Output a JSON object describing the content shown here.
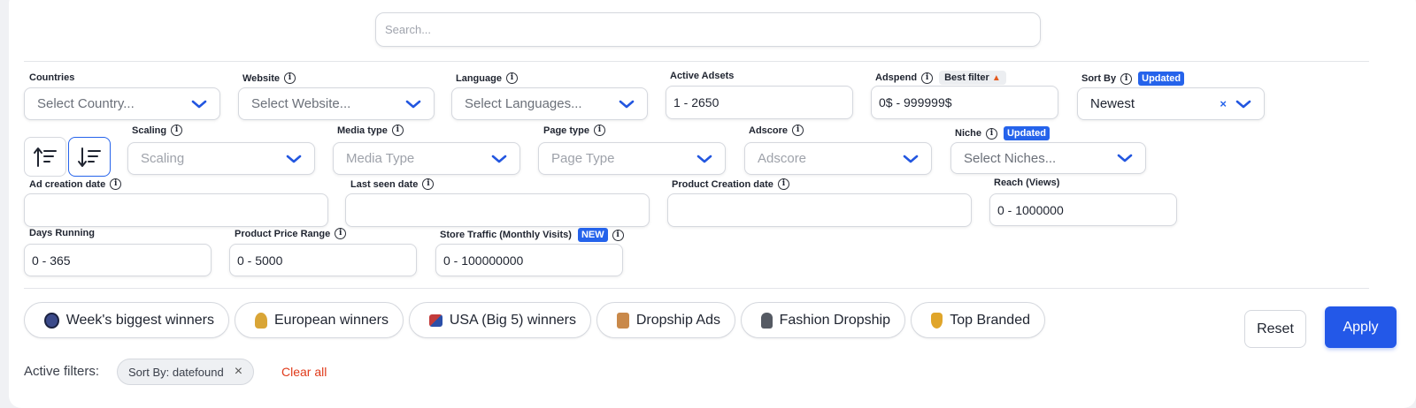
{
  "search": {
    "placeholder": "Search..."
  },
  "filters": {
    "countries": {
      "label": "Countries",
      "placeholder": "Select Country..."
    },
    "website": {
      "label": "Website",
      "placeholder": "Select Website..."
    },
    "language": {
      "label": "Language",
      "placeholder": "Select Languages..."
    },
    "active_adsets": {
      "label": "Active Adsets",
      "value": "1 - 2650"
    },
    "adspend": {
      "label": "Adspend",
      "badge": "Best filter",
      "badge_icon": "fire",
      "value": "0$ - 999999$"
    },
    "sort_by": {
      "label": "Sort By",
      "badge": "Updated",
      "value": "Newest",
      "clear": "×"
    },
    "scaling": {
      "label": "Scaling",
      "placeholder": "Scaling"
    },
    "media_type": {
      "label": "Media type",
      "placeholder": "Media Type"
    },
    "page_type": {
      "label": "Page type",
      "placeholder": "Page Type"
    },
    "adscore": {
      "label": "Adscore",
      "placeholder": "Adscore"
    },
    "niche": {
      "label": "Niche",
      "badge": "Updated",
      "placeholder": "Select Niches..."
    },
    "ad_creation_date": {
      "label": "Ad creation date",
      "value": ""
    },
    "last_seen_date": {
      "label": "Last seen date",
      "value": ""
    },
    "product_creation_date": {
      "label": "Product Creation date",
      "value": ""
    },
    "reach": {
      "label": "Reach (Views)",
      "value": "0 - 1000000"
    },
    "days_running": {
      "label": "Days Running",
      "value": "0 - 365"
    },
    "product_price_range": {
      "label": "Product Price Range",
      "value": "0 - 5000"
    },
    "store_traffic": {
      "label": "Store Traffic (Monthly Visits)",
      "badge": "NEW",
      "value": "0 - 100000000"
    }
  },
  "presets": [
    {
      "label": "Week's biggest winners",
      "icon": "globe-icon"
    },
    {
      "label": "European winners",
      "icon": "europe-medal-icon"
    },
    {
      "label": "USA (Big 5) winners",
      "icon": "crossed-flags-icon"
    },
    {
      "label": "Dropship Ads",
      "icon": "package-icon"
    },
    {
      "label": "Fashion Dropship",
      "icon": "coat-icon"
    },
    {
      "label": "Top Branded",
      "icon": "trophy-icon"
    }
  ],
  "actions": {
    "reset": "Reset",
    "apply": "Apply"
  },
  "active_filters": {
    "label": "Active filters:",
    "items": [
      {
        "label": "Sort By: datefound",
        "remove": "×"
      }
    ],
    "clear_all": "Clear all"
  },
  "colors": {
    "accent": "#2563eb",
    "danger": "#e03a1a"
  }
}
